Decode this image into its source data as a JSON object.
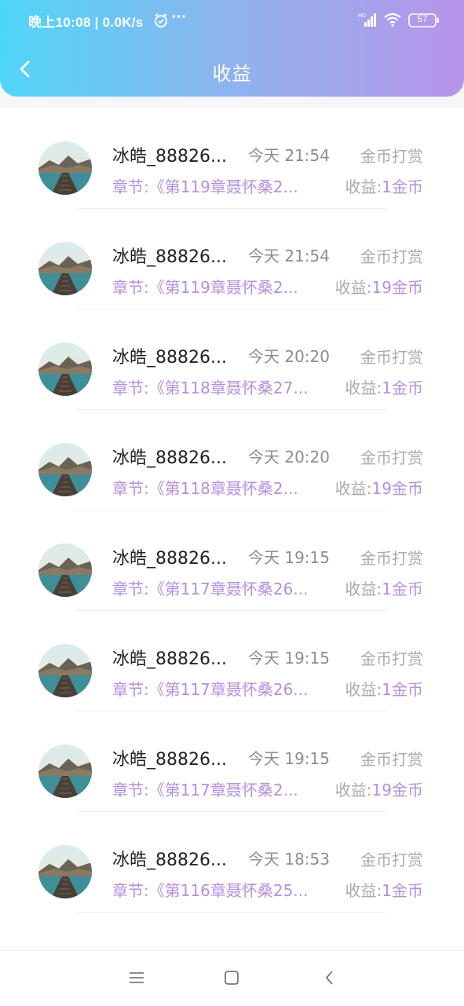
{
  "status_bar": {
    "time_speed": "晚上10:08 | 0.0K/s",
    "more": "···",
    "battery": "57"
  },
  "header": {
    "title": "收益"
  },
  "colors": {
    "header_gradient_start": "#4fd6f7",
    "header_gradient_end": "#b894ea",
    "accent_purple": "#b58fdd",
    "muted_gray": "#aaaaaa"
  },
  "icons": {
    "back": "chevron-left-icon",
    "alarm": "alarm-icon",
    "signal": "hd-signal-icon",
    "wifi": "wifi-icon",
    "battery": "battery-icon",
    "nav_menu": "menu-icon",
    "nav_home": "home-square-icon",
    "nav_back": "back-icon"
  },
  "records": [
    {
      "user": "冰皓_88826...",
      "time": "今天 21:54",
      "type": "金币打赏",
      "chapter": "章节:《第119章聂怀桑2...",
      "income_label": "收益:",
      "income_value": "1金币"
    },
    {
      "user": "冰皓_88826...",
      "time": "今天 21:54",
      "type": "金币打赏",
      "chapter": "章节:《第119章聂怀桑2...",
      "income_label": "收益:",
      "income_value": "19金币"
    },
    {
      "user": "冰皓_88826...",
      "time": "今天 20:20",
      "type": "金币打赏",
      "chapter": "章节:《第118章聂怀桑27...",
      "income_label": "收益:",
      "income_value": "1金币"
    },
    {
      "user": "冰皓_88826...",
      "time": "今天 20:20",
      "type": "金币打赏",
      "chapter": "章节:《第118章聂怀桑2...",
      "income_label": "收益:",
      "income_value": "19金币"
    },
    {
      "user": "冰皓_88826...",
      "time": "今天 19:15",
      "type": "金币打赏",
      "chapter": "章节:《第117章聂怀桑26...",
      "income_label": "收益:",
      "income_value": "1金币"
    },
    {
      "user": "冰皓_88826...",
      "time": "今天 19:15",
      "type": "金币打赏",
      "chapter": "章节:《第117章聂怀桑26...",
      "income_label": "收益:",
      "income_value": "1金币"
    },
    {
      "user": "冰皓_88826...",
      "time": "今天 19:15",
      "type": "金币打赏",
      "chapter": "章节:《第117章聂怀桑2...",
      "income_label": "收益:",
      "income_value": "19金币"
    },
    {
      "user": "冰皓_88826...",
      "time": "今天 18:53",
      "type": "金币打赏",
      "chapter": "章节:《第116章聂怀桑25...",
      "income_label": "收益:",
      "income_value": "1金币"
    }
  ]
}
